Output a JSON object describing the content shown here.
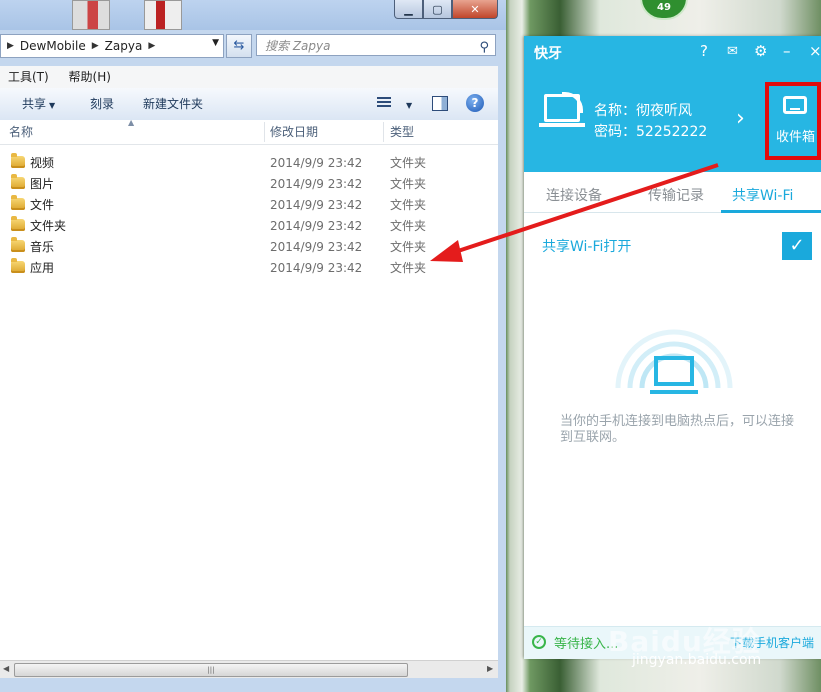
{
  "desktop": {
    "badge": "49"
  },
  "explorer": {
    "breadcrumb": [
      "DewMobile",
      "Zapya"
    ],
    "search_placeholder": "搜索 Zapya",
    "menu": [
      "工具(T)",
      "帮助(H)"
    ],
    "toolbar": {
      "share": "共享",
      "burn": "刻录",
      "new_folder": "新建文件夹"
    },
    "columns": {
      "name": "名称",
      "date": "修改日期",
      "type": "类型"
    },
    "rows": [
      {
        "name": "视频",
        "date": "2014/9/9 23:42",
        "type": "文件夹"
      },
      {
        "name": "图片",
        "date": "2014/9/9 23:42",
        "type": "文件夹"
      },
      {
        "name": "文件",
        "date": "2014/9/9 23:42",
        "type": "文件夹"
      },
      {
        "name": "文件夹",
        "date": "2014/9/9 23:42",
        "type": "文件夹"
      },
      {
        "name": "音乐",
        "date": "2014/9/9 23:42",
        "type": "文件夹"
      },
      {
        "name": "应用",
        "date": "2014/9/9 23:42",
        "type": "文件夹"
      }
    ]
  },
  "zapya": {
    "logo": "快牙",
    "controls": {
      "help": "?",
      "mail": "✉",
      "settings": "⚙",
      "minimize": "–",
      "close": "×"
    },
    "name_line": "名称：彻夜听风",
    "password_line": "密码：52252222",
    "inbox_label": "收件箱",
    "tabs": [
      "连接设备",
      "传输记录",
      "共享Wi-Fi"
    ],
    "wifi_toggle_label": "共享Wi-Fi打开",
    "hint": "当你的手机连接到电脑热点后，可以连接到互联网。",
    "status_text": "等待接入...",
    "status_link": "下载手机客户端"
  },
  "watermark": {
    "brand": "Baidu经验",
    "url": "jingyan.baidu.com"
  },
  "colors": {
    "accent": "#27b6e3",
    "highlight_red": "#e20b0b",
    "status_green": "#39b54a"
  }
}
